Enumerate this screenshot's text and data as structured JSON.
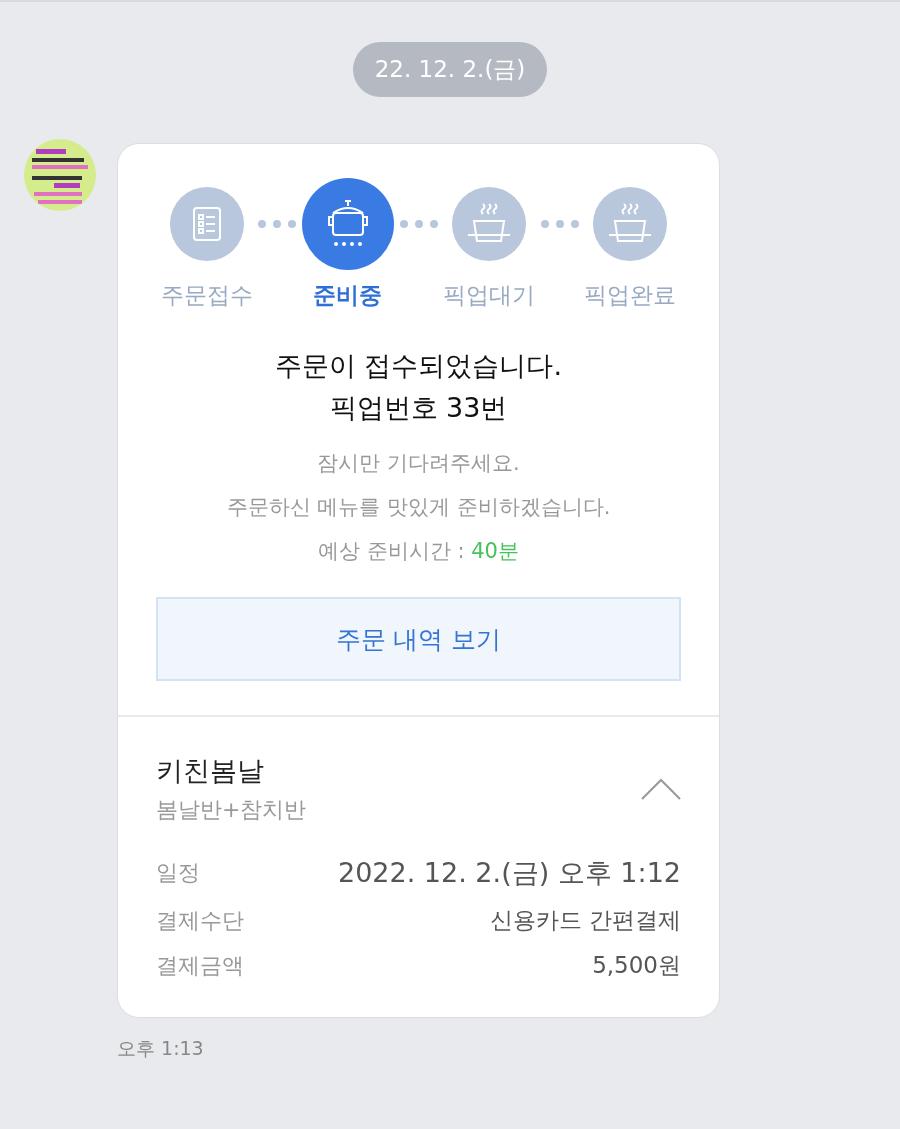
{
  "date_divider": "22. 12. 2.(금)",
  "message": {
    "avatar": {
      "kind": "picture"
    },
    "steps": [
      {
        "label": "주문접수",
        "kind": "list",
        "selected": false
      },
      {
        "label": "준비중",
        "kind": "pot",
        "selected": true
      },
      {
        "label": "픽업대기",
        "kind": "bowl",
        "selected": false
      },
      {
        "label": "픽업완료",
        "kind": "bowl",
        "selected": false
      }
    ],
    "title_lines": [
      "주문이 접수되었습니다.",
      "픽업번호 33번"
    ],
    "notice_lines": [
      "잠시만 기다려주세요.",
      "주문하신 메뉴를 맛있게 준비하겠습니다."
    ],
    "eta": {
      "label": "예상 준비시간 :",
      "value": "40분"
    },
    "order_button": "주문 내역 보기",
    "store": {
      "name": "키친봄날",
      "menu": "봄날반+참치반",
      "expanded": true
    },
    "details": [
      {
        "label": "일정",
        "value": "2022. 12. 2.(금) 오후 1:12",
        "emphasis": true
      },
      {
        "label": "결제수단",
        "value": "신용카드 간편결제",
        "emphasis": false
      },
      {
        "label": "결제금액",
        "value": "5,500원",
        "emphasis": false
      }
    ],
    "time": "오후 1:13"
  }
}
